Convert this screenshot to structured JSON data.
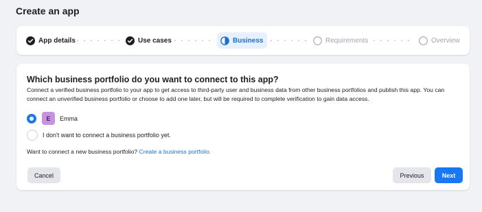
{
  "page": {
    "title": "Create an app"
  },
  "stepper": {
    "steps": [
      {
        "label": "App details",
        "status": "complete"
      },
      {
        "label": "Use cases",
        "status": "complete"
      },
      {
        "label": "Business",
        "status": "active"
      },
      {
        "label": "Requirements",
        "status": "pending"
      },
      {
        "label": "Overview",
        "status": "pending"
      }
    ]
  },
  "card": {
    "question": "Which business portfolio do you want to connect to this app?",
    "description": "Connect a verified business portfolio to your app to get access to third-party user and business data from other business portfolios and publish this app. You can connect an unverified business portfolio or choose to add one later, but will be required to complete verification to gain data access.",
    "options": [
      {
        "avatar_letter": "E",
        "label": "Emma",
        "selected": true
      },
      {
        "label": "I don't want to connect a business portfolio yet.",
        "selected": false
      }
    ],
    "new_portfolio_text": "Want to connect a new business portfolio?",
    "new_portfolio_link": "Create a business portfolio."
  },
  "buttons": {
    "cancel": "Cancel",
    "previous": "Previous",
    "next": "Next"
  },
  "colors": {
    "accent": "#1877f2",
    "complete": "#1c1e21",
    "avatar": "#c792e0"
  }
}
